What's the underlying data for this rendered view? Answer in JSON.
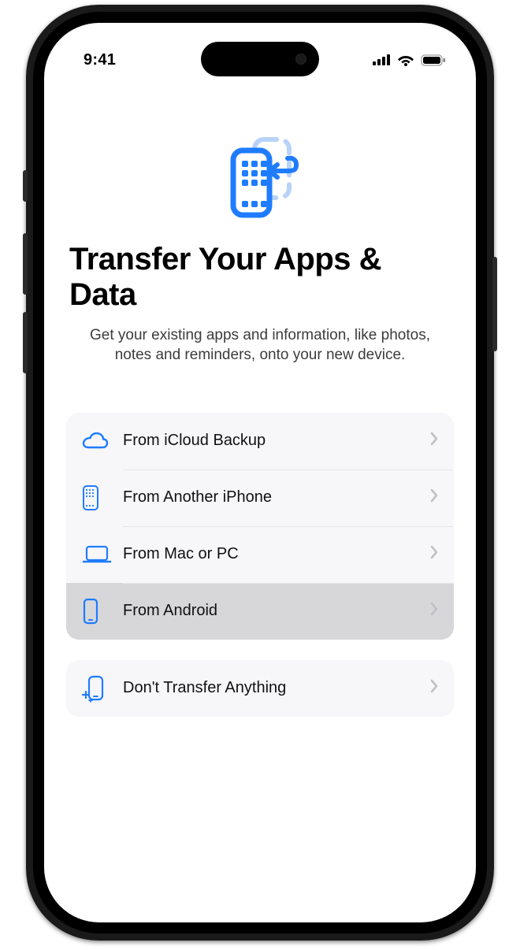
{
  "status": {
    "time": "9:41"
  },
  "header": {
    "title": "Transfer Your Apps & Data",
    "subtitle": "Get your existing apps and information, like photos, notes and reminders, onto your new device."
  },
  "options_group1": [
    {
      "icon": "cloud-icon",
      "label": "From iCloud Backup",
      "selected": false
    },
    {
      "icon": "iphone-icon",
      "label": "From Another iPhone",
      "selected": false
    },
    {
      "icon": "laptop-icon",
      "label": "From Mac or PC",
      "selected": false
    },
    {
      "icon": "android-icon",
      "label": "From Android",
      "selected": true
    }
  ],
  "options_group2": [
    {
      "icon": "sparkle-phone-icon",
      "label": "Don't Transfer Anything",
      "selected": false
    }
  ],
  "colors": {
    "accent": "#1f7cff",
    "accent_light": "#b8d3f9",
    "row_bg": "#f7f7f9",
    "row_selected": "#d7d7da"
  }
}
